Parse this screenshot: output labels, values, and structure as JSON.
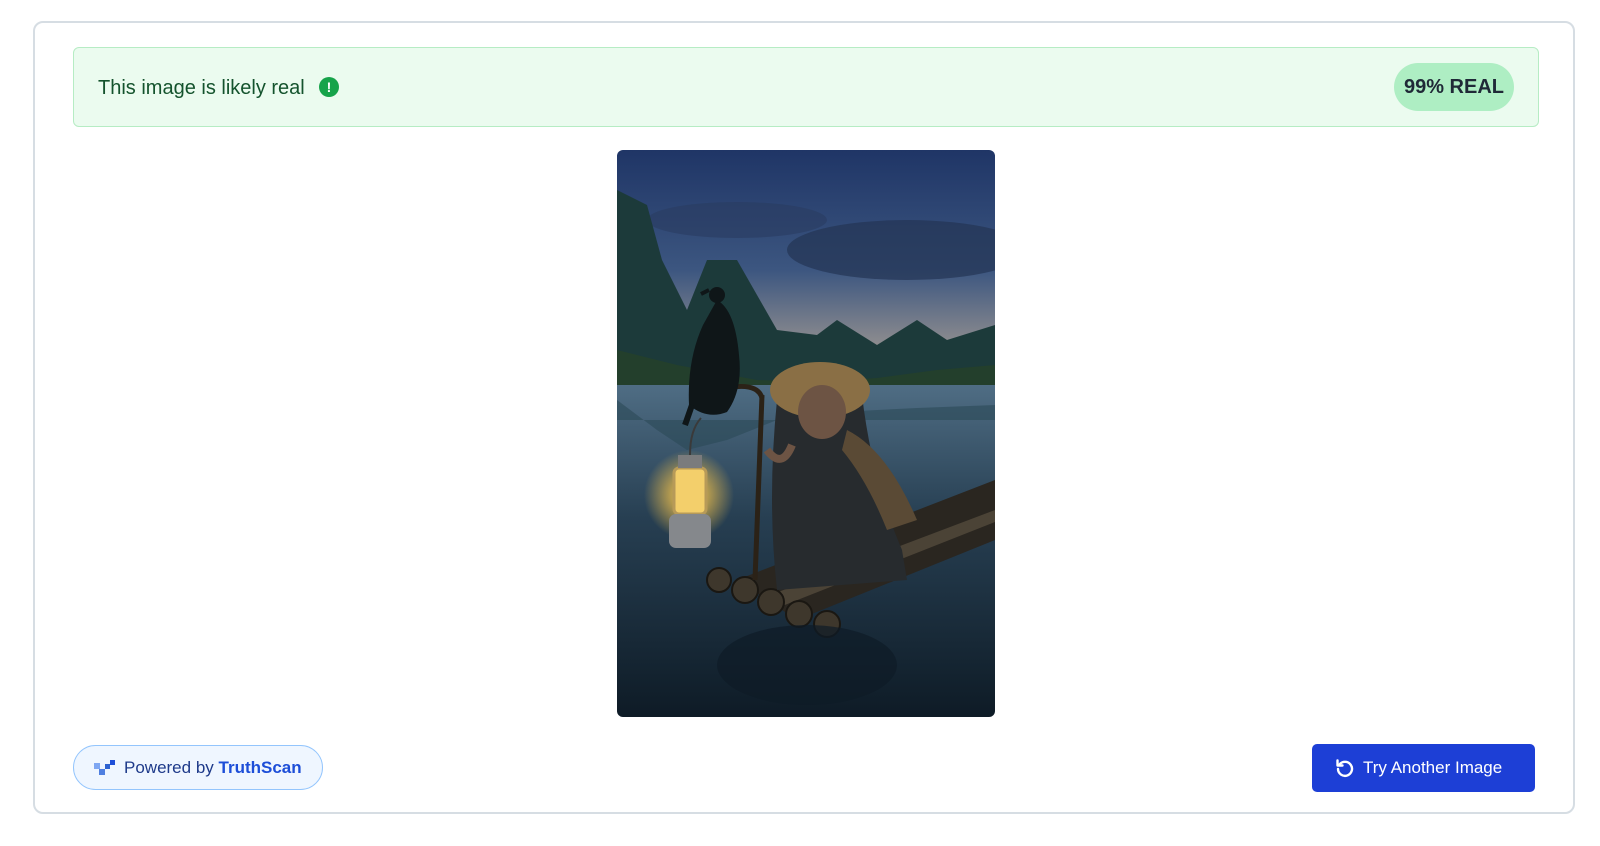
{
  "result": {
    "message": "This image is likely real",
    "status_icon": "exclamation-circle-icon",
    "score_label": "99% REAL",
    "score_percent": 99,
    "accent_color": "#16a34a",
    "banner_background": "#ebfbef"
  },
  "preview": {
    "subject": "cormorant-fisherman-photo"
  },
  "footer": {
    "powered_prefix": "Powered by",
    "powered_brand": "TruthScan",
    "brand_icon": "truthscan-logo-icon",
    "try_button_label": "Try Another Image",
    "try_button_icon": "refresh-icon",
    "button_color": "#1d3fd6"
  }
}
